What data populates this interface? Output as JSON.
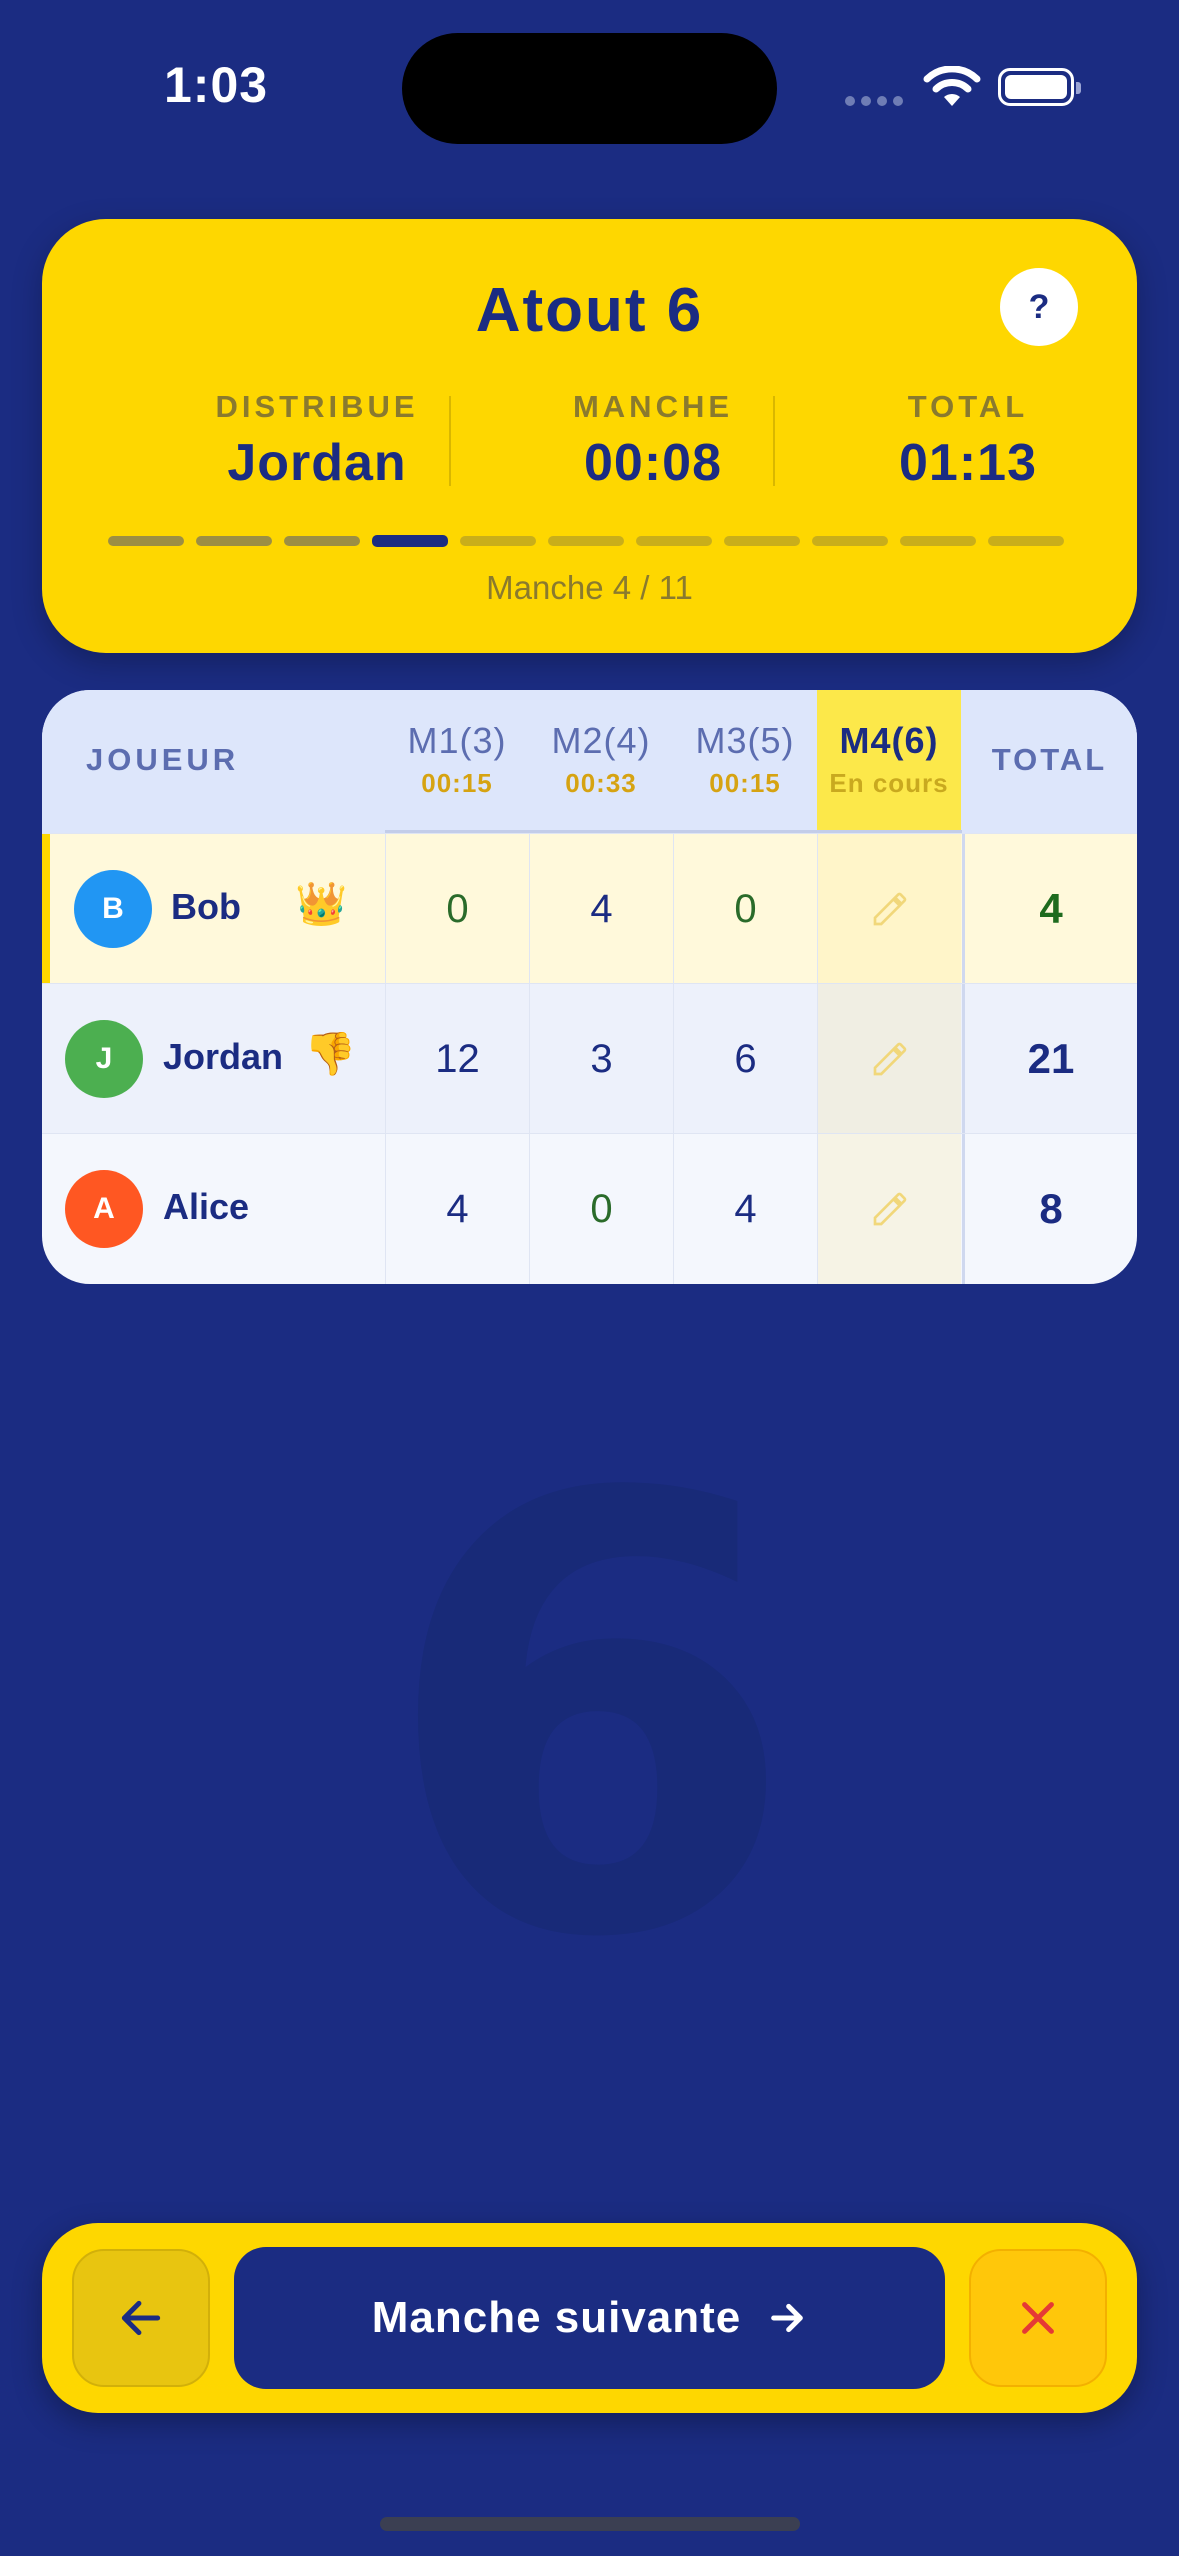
{
  "status_bar": {
    "time": "1:03"
  },
  "header": {
    "title": "Atout 6",
    "help_label": "?",
    "stats": [
      {
        "label": "DISTRIBUE",
        "value": "Jordan"
      },
      {
        "label": "MANCHE",
        "value": "00:08"
      },
      {
        "label": "TOTAL",
        "value": "01:13"
      }
    ],
    "progress": {
      "current": 4,
      "total": 11
    },
    "caption": "Manche 4 / 11"
  },
  "table": {
    "player_header": "JOUEUR",
    "total_header": "TOTAL",
    "rounds": [
      {
        "name": "M1(3)",
        "time": "00:15"
      },
      {
        "name": "M2(4)",
        "time": "00:33"
      },
      {
        "name": "M3(5)",
        "time": "00:15"
      },
      {
        "name": "M4(6)",
        "time": "En cours"
      }
    ],
    "players": [
      {
        "initial": "B",
        "name": "Bob",
        "emoji": "👑",
        "avatar_color": "#2196f3",
        "scores": [
          "0",
          "4",
          "0"
        ],
        "total": "4",
        "leader": true
      },
      {
        "initial": "J",
        "name": "Jordan",
        "emoji": "👎",
        "avatar_color": "#4caf50",
        "scores": [
          "12",
          "3",
          "6"
        ],
        "total": "21",
        "leader": false
      },
      {
        "initial": "A",
        "name": "Alice",
        "emoji": "",
        "avatar_color": "#ff5722",
        "scores": [
          "4",
          "0",
          "4"
        ],
        "total": "8",
        "leader": false
      }
    ],
    "edit_icon": "pencil-icon"
  },
  "background_trump": "6",
  "actions": {
    "back_icon": "arrow-left-icon",
    "next_label": "Manche suivante",
    "next_icon": "arrow-right-icon",
    "close_icon": "close-icon"
  },
  "colors": {
    "background": "#1b2c82",
    "accent_yellow": "#fed700",
    "navy": "#1b2c82",
    "close_red": "#e53935"
  }
}
